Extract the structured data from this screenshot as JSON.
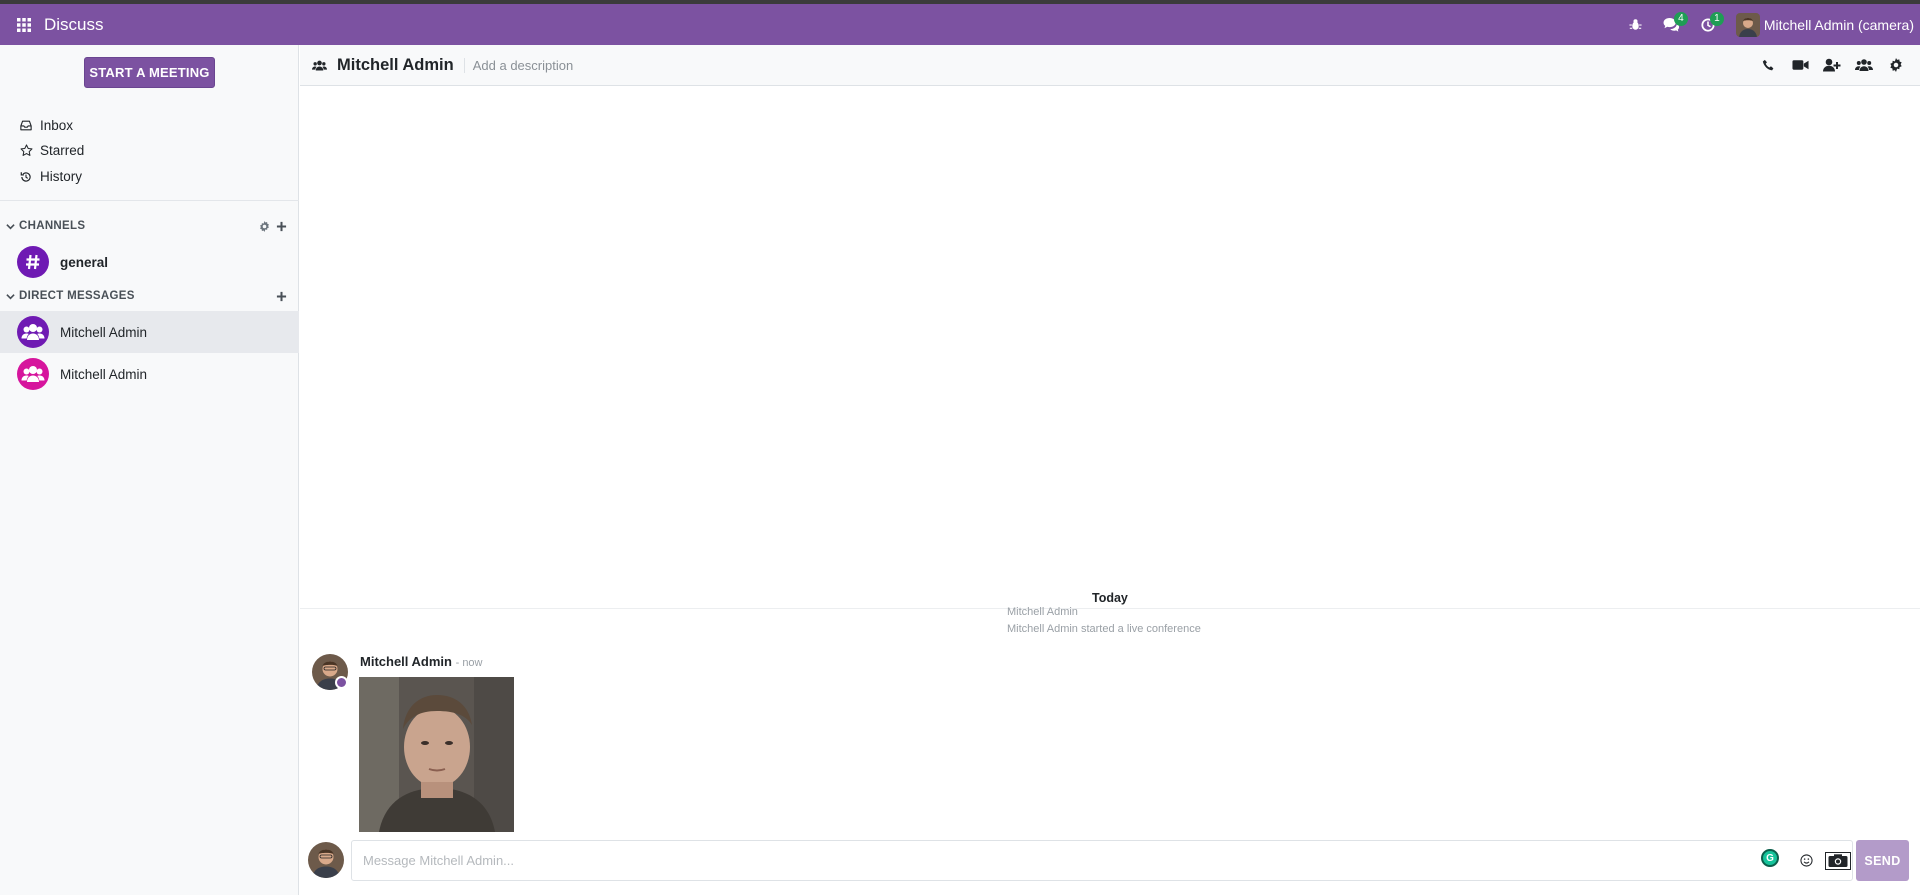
{
  "navbar": {
    "app_title": "Discuss",
    "messages_badge": "4",
    "activities_badge": "1",
    "user_name": "Mitchell Admin (camera)"
  },
  "sidebar": {
    "start_meeting_label": "START A MEETING",
    "mailboxes": [
      {
        "label": "Inbox",
        "icon": "inbox-icon"
      },
      {
        "label": "Starred",
        "icon": "star-icon"
      },
      {
        "label": "History",
        "icon": "history-icon"
      }
    ],
    "channels_label": "CHANNELS",
    "channels": [
      {
        "label": "general"
      }
    ],
    "direct_messages_label": "DIRECT MESSAGES",
    "direct_messages": [
      {
        "label": "Mitchell Admin",
        "color": "#6f1ab3"
      },
      {
        "label": "Mitchell Admin",
        "color": "#d6159d"
      }
    ]
  },
  "thread": {
    "name": "Mitchell Admin",
    "description_placeholder": "Add a description",
    "actions": [
      "phone-icon",
      "video-camera-icon",
      "add-user-icon",
      "members-icon",
      "settings-icon"
    ]
  },
  "messages": {
    "date_label": "Today",
    "notification_author": "Mitchell Admin",
    "notification_text": "Mitchell Admin started a live conference",
    "message_author": "Mitchell Admin",
    "message_time": "- now"
  },
  "composer": {
    "placeholder": "Message Mitchell Admin...",
    "send_label": "SEND"
  },
  "colors": {
    "brand": "#7c52a1",
    "presence": "#7c52a1",
    "send_disabled": "#b39bc9"
  }
}
